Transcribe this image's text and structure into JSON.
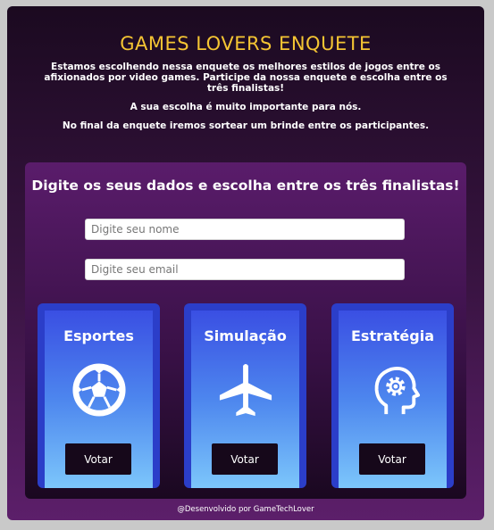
{
  "header": {
    "title": "GAMES LOVERS ENQUETE"
  },
  "intro": {
    "paragraph1": "Estamos escolhendo nessa enquete os melhores estilos de jogos entre os afixionados por video games. Participe da nossa enquete e escolha entre os três finalistas!",
    "paragraph2": "A sua escolha é muito importante para nós.",
    "paragraph3": "No final da enquete iremos sortear um brinde entre os participantes."
  },
  "form": {
    "title": "Digite os seus dados e escolha entre os três finalistas!",
    "name_placeholder": "Digite seu nome",
    "email_placeholder": "Digite seu email"
  },
  "options": [
    {
      "title": "Esportes",
      "icon": "soccer-ball-icon",
      "vote_label": "Votar"
    },
    {
      "title": "Simulação",
      "icon": "airplane-icon",
      "vote_label": "Votar"
    },
    {
      "title": "Estratégia",
      "icon": "head-gear-icon",
      "vote_label": "Votar"
    }
  ],
  "footer": {
    "credit": "@Desenvolvido por GameTechLover"
  },
  "colors": {
    "title": "#f5c533",
    "card_border": "#2b3ec9",
    "button_bg": "#16081a"
  }
}
